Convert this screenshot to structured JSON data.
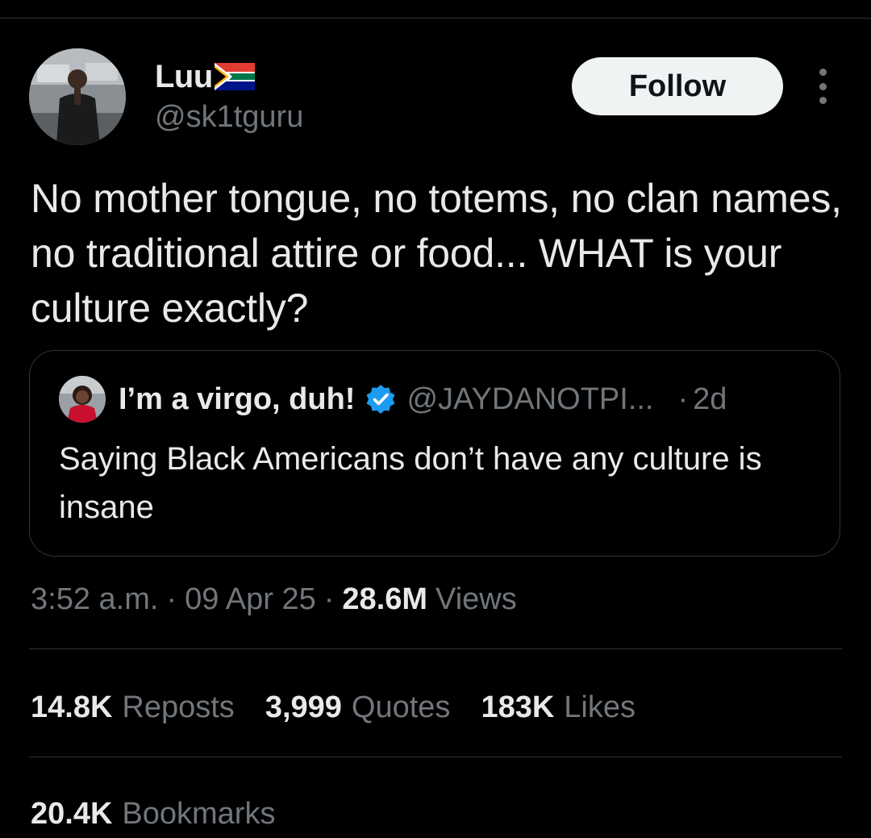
{
  "author": {
    "display_name": "Luu",
    "flag_icon": "south-africa-flag-icon",
    "handle": "@sk1tguru",
    "avatar_icon": "user-avatar"
  },
  "follow_button": {
    "label": "Follow"
  },
  "more_icon": "more-options-icon",
  "tweet": {
    "text": "No mother tongue, no totems, no clan names, no traditional attire or food... WHAT is your culture exactly?"
  },
  "quoted_tweet": {
    "display_name": "I’m a virgo, duh!",
    "verified_icon": "verified-badge-icon",
    "handle": "@JAYDANOTPI...",
    "separator": "·",
    "time": "2d",
    "text": "Saying Black Americans don’t have any culture is insane"
  },
  "meta": {
    "time": "3:52 a.m.",
    "separator": "·",
    "date": "09 Apr 25",
    "views_count": "28.6M",
    "views_label": "Views"
  },
  "stats": {
    "reposts_count": "14.8K",
    "reposts_label": "Reposts",
    "quotes_count": "3,999",
    "quotes_label": "Quotes",
    "likes_count": "183K",
    "likes_label": "Likes",
    "bookmarks_count": "20.4K",
    "bookmarks_label": "Bookmarks"
  },
  "colors": {
    "background": "#000000",
    "primary_text": "#e7e9ea",
    "secondary_text": "#71767b",
    "divider": "#2f3336",
    "verified": "#1d9bf0",
    "follow_bg": "#eff3f4"
  }
}
